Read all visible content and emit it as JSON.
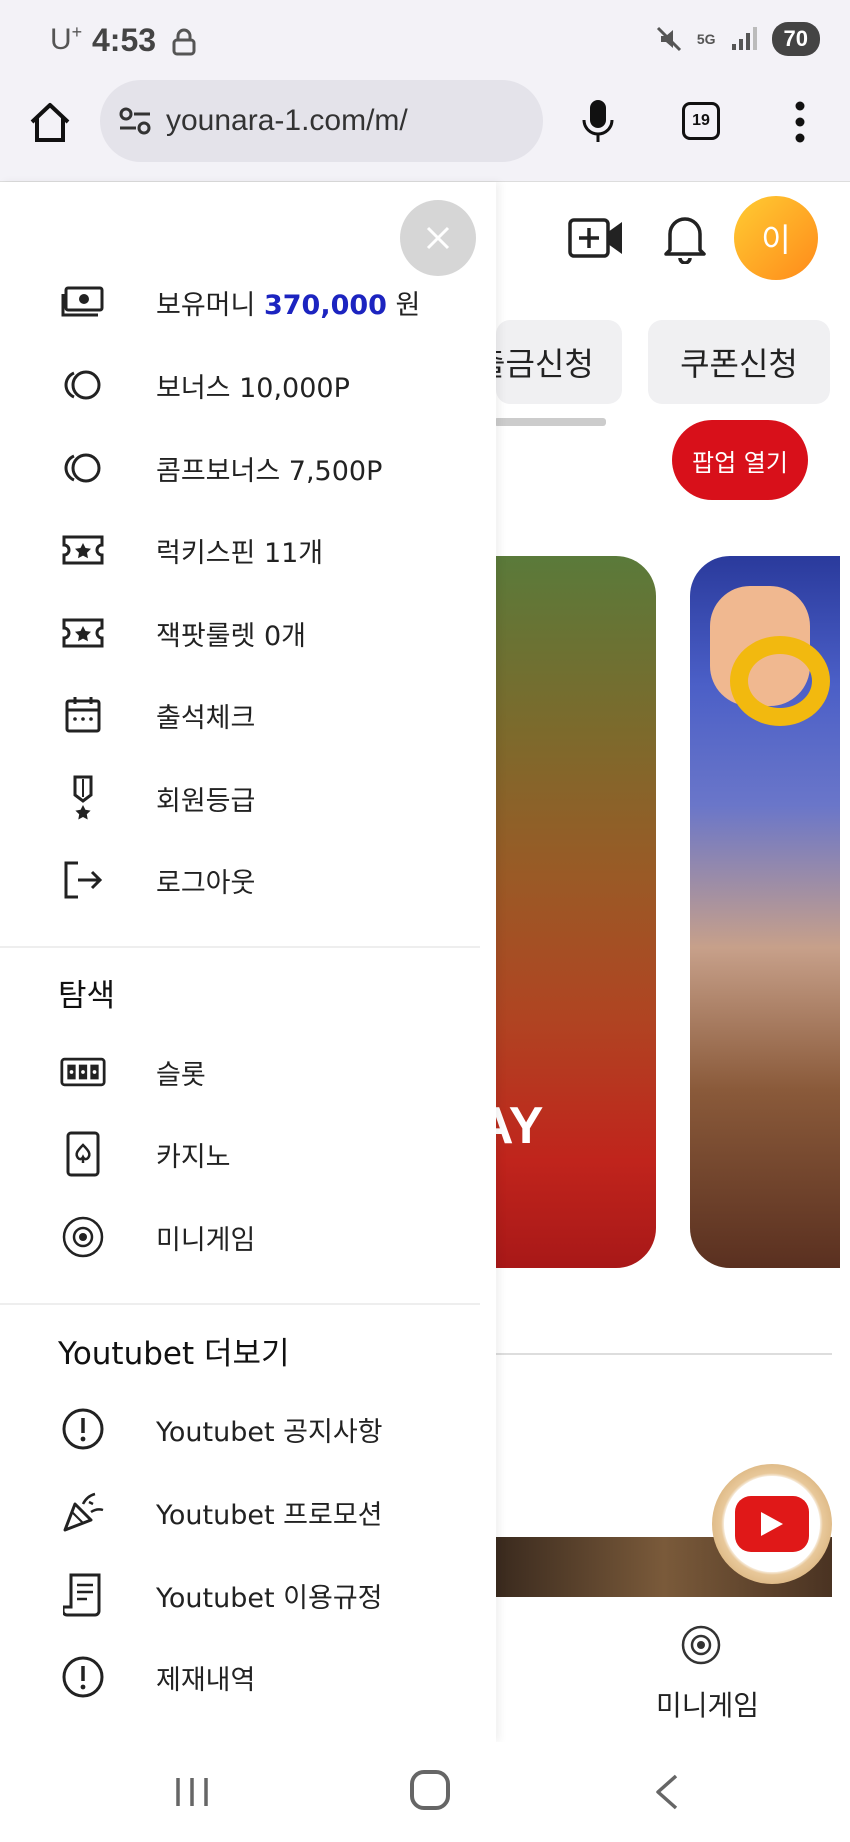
{
  "status_bar": {
    "carrier": "U",
    "carrier_plus": "+",
    "time": "4:53",
    "network": "5G",
    "battery": "70"
  },
  "browser": {
    "url": "younara-1.com/m/",
    "tab_count": "19"
  },
  "header": {
    "avatar_initial": "이",
    "buttons": {
      "withdraw_partial": "출금신청",
      "coupon": "쿠폰신청",
      "popup": "팝업 열기"
    }
  },
  "drawer": {
    "account_items": [
      {
        "icon": "money-icon",
        "label_prefix": "보유머니",
        "amount": "370,000",
        "unit": "원"
      },
      {
        "icon": "coin-icon",
        "label": "보너스 10,000P"
      },
      {
        "icon": "coin-icon",
        "label": "콤프보너스 7,500P"
      },
      {
        "icon": "ticket-icon",
        "label": "럭키스핀 11개"
      },
      {
        "icon": "ticket-icon",
        "label": "잭팟룰렛 0개"
      },
      {
        "icon": "calendar-icon",
        "label": "출석체크"
      },
      {
        "icon": "medal-icon",
        "label": "회원등급"
      },
      {
        "icon": "logout-icon",
        "label": "로그아웃"
      }
    ],
    "explore_title": "탐색",
    "explore_items": [
      {
        "icon": "slot-icon",
        "label": "슬롯"
      },
      {
        "icon": "card-icon",
        "label": "카지노"
      },
      {
        "icon": "minigame-icon",
        "label": "미니게임"
      }
    ],
    "more_title": "Youtubet 더보기",
    "more_items": [
      {
        "icon": "notice-icon",
        "label": "Youtubet 공지사항"
      },
      {
        "icon": "party-icon",
        "label": "Youtubet 프로모션"
      },
      {
        "icon": "document-icon",
        "label": "Youtubet 이용규정"
      },
      {
        "icon": "notice-icon",
        "label": "제재내역"
      }
    ]
  },
  "banner": {
    "partial_text": "AY"
  },
  "bottom_nav": {
    "minigame_label": "미니게임"
  },
  "colors": {
    "accent_money": "#1c24c0",
    "popup_button": "#d8101a",
    "avatar_gradient_start": "#ffcc33",
    "avatar_gradient_end": "#ff8a1a"
  }
}
